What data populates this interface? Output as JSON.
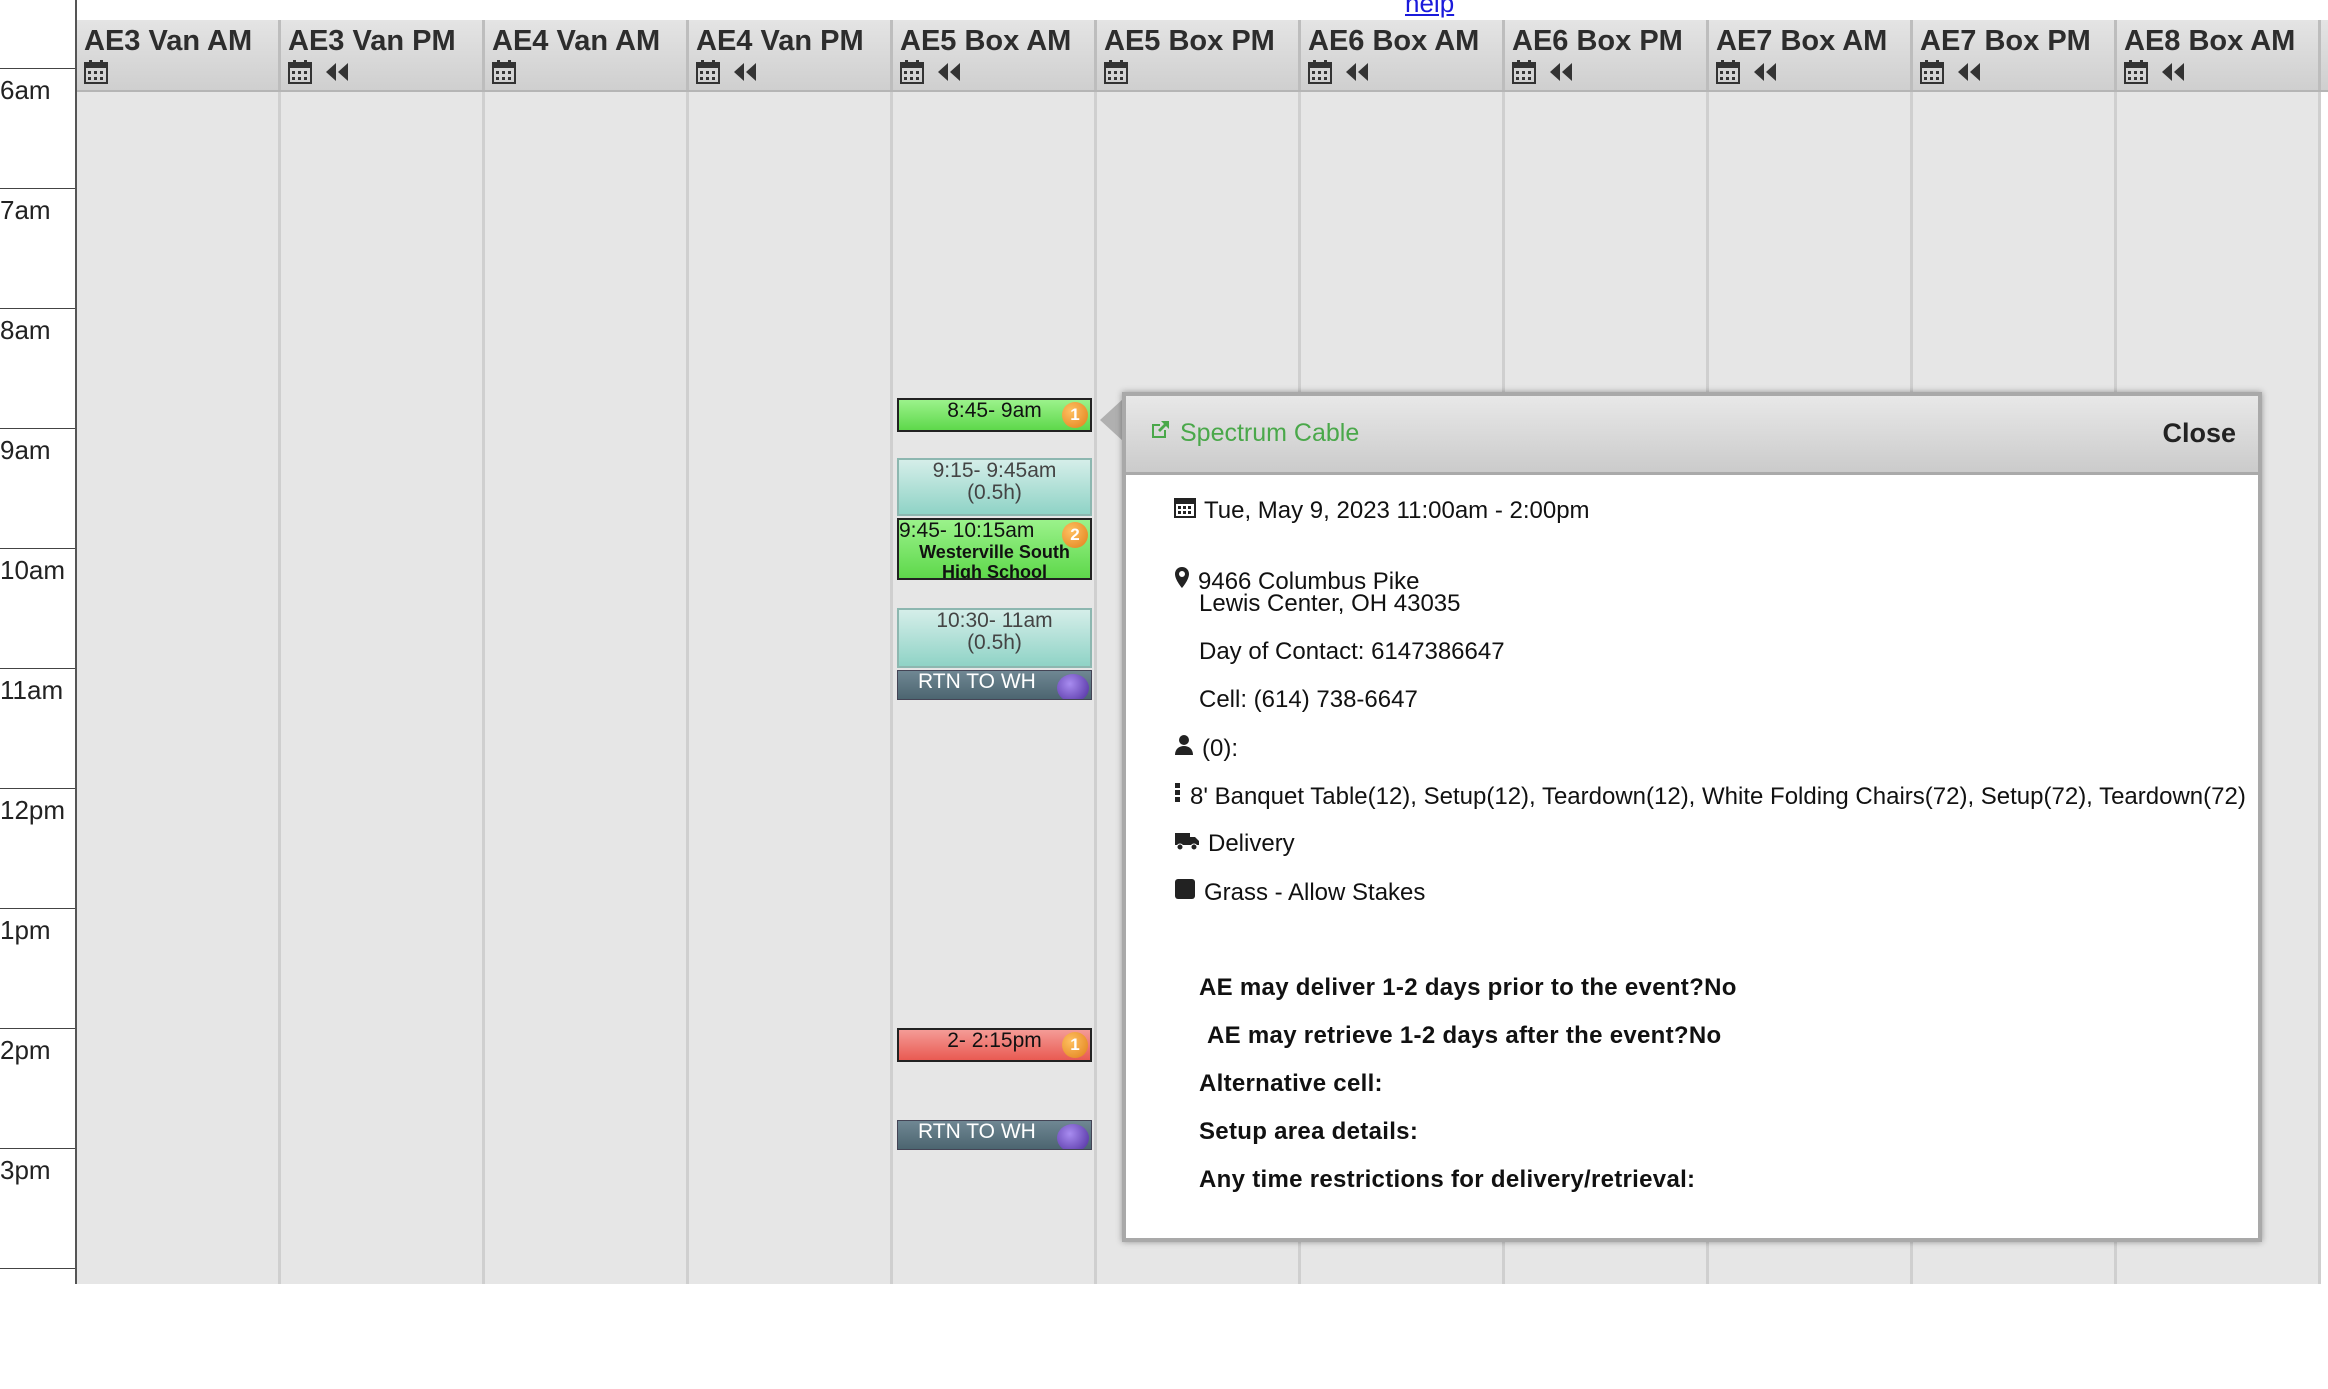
{
  "help": {
    "label": "help"
  },
  "times": [
    "6am",
    "7am",
    "8am",
    "9am",
    "10am",
    "11am",
    "12pm",
    "1pm",
    "2pm",
    "3pm"
  ],
  "columns": [
    {
      "title": "AE3 Van AM",
      "rewind": false
    },
    {
      "title": "AE3 Van PM",
      "rewind": true
    },
    {
      "title": "AE4 Van AM",
      "rewind": false
    },
    {
      "title": "AE4 Van PM",
      "rewind": true
    },
    {
      "title": "AE5 Box AM",
      "rewind": true
    },
    {
      "title": "AE5 Box PM",
      "rewind": false
    },
    {
      "title": "AE6 Box AM",
      "rewind": true
    },
    {
      "title": "AE6 Box PM",
      "rewind": true
    },
    {
      "title": "AE7 Box AM",
      "rewind": true
    },
    {
      "title": "AE7 Box PM",
      "rewind": true
    },
    {
      "title": "AE8 Box AM",
      "rewind": true
    }
  ],
  "events": {
    "e1": {
      "time": "8:45- 9am",
      "badge": "1"
    },
    "e2": {
      "time": "9:15- 9:45am",
      "duration": "(0.5h)"
    },
    "e3": {
      "time": "9:45- 10:15am",
      "badge": "2",
      "name": "Westerville South High School"
    },
    "e4": {
      "time": "10:30- 11am",
      "duration": "(0.5h)"
    },
    "e5": {
      "label": "RTN TO WH"
    },
    "e6": {
      "time": "2- 2:15pm",
      "badge": "1"
    },
    "e7": {
      "label": "RTN TO WH"
    }
  },
  "popover": {
    "title": "Spectrum Cable",
    "close": "Close",
    "datetime": "Tue, May 9, 2023 11:00am - 2:00pm",
    "address1": "9466 Columbus Pike",
    "address2": "Lewis Center, OH 43035",
    "day_contact": "Day of Contact: 6147386647",
    "cell": "Cell: (614) 738-6647",
    "people": "(0):",
    "items": "8' Banquet Table(12), Setup(12), Teardown(12), White Folding Chairs(72), Setup(72), Teardown(72)",
    "delivery": "Delivery",
    "surface": "Grass - Allow Stakes",
    "q_deliver": "AE may deliver 1-2 days prior to the event?No",
    "q_retrieve": "AE may retrieve 1-2 days after the event?No",
    "q_alt_cell": "Alternative cell:",
    "q_setup": "Setup area details:",
    "q_time": "Any time restrictions for delivery/retrieval:"
  }
}
